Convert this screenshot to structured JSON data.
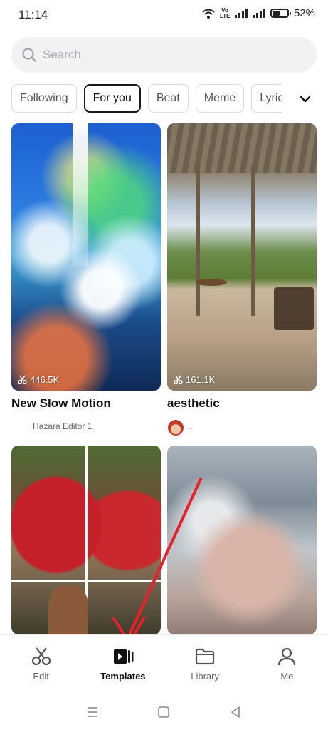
{
  "status_bar": {
    "time": "11:14",
    "lte_label": "Vo LTE",
    "battery": "52%",
    "battery_level": 0.52
  },
  "search": {
    "placeholder": "Search",
    "icon": "search-icon"
  },
  "categories": {
    "items": [
      "Following",
      "For you",
      "Beat",
      "Meme",
      "Lyric"
    ],
    "selected": "For you",
    "expand_icon": "chevron-down-icon"
  },
  "templates": [
    {
      "title": "New Slow Motion",
      "uses": "446.5K",
      "author": "Hazara Editor 1"
    },
    {
      "title": "aesthetic",
      "uses": "161.1K",
      "author": "."
    },
    {
      "title": "",
      "uses": "",
      "author": ""
    },
    {
      "title": "",
      "uses": "",
      "author": ""
    }
  ],
  "bottom_nav": {
    "items": [
      {
        "label": "Edit",
        "icon": "scissors-icon"
      },
      {
        "label": "Templates",
        "icon": "templates-icon"
      },
      {
        "label": "Library",
        "icon": "folder-icon"
      },
      {
        "label": "Me",
        "icon": "person-icon"
      }
    ],
    "active": "Templates"
  },
  "system_nav": [
    "menu-icon",
    "home-icon",
    "back-icon"
  ],
  "colors": {
    "accent": "#111111",
    "annotation_arrow": "#e8202a",
    "search_bg": "#f1f2f4"
  }
}
